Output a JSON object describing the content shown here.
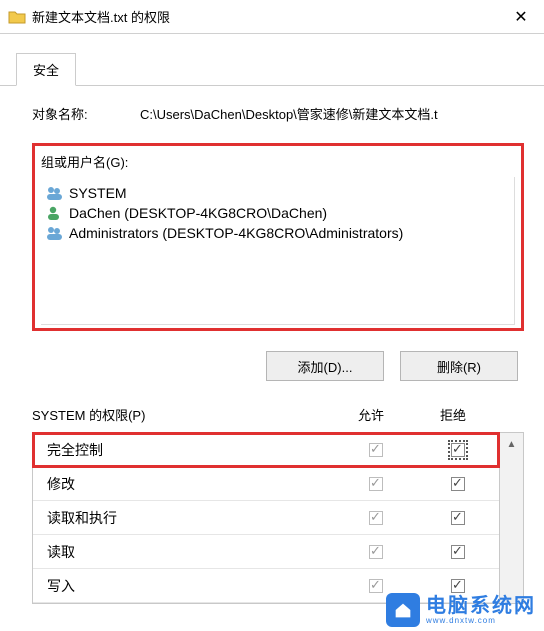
{
  "titlebar": {
    "title": "新建文本文档.txt 的权限"
  },
  "tab": {
    "label": "安全"
  },
  "object": {
    "label": "对象名称:",
    "path": "C:\\Users\\DaChen\\Desktop\\管家速修\\新建文本文档.t"
  },
  "groups": {
    "label": "组或用户名(G):",
    "items": [
      {
        "name": "SYSTEM",
        "icon": "group"
      },
      {
        "name": "DaChen (DESKTOP-4KG8CRO\\DaChen)",
        "icon": "user"
      },
      {
        "name": "Administrators (DESKTOP-4KG8CRO\\Administrators)",
        "icon": "group"
      }
    ]
  },
  "buttons": {
    "add": "添加(D)...",
    "remove": "删除(R)"
  },
  "perm_header": {
    "label": "SYSTEM 的权限(P)",
    "allow": "允许",
    "deny": "拒绝"
  },
  "permissions": [
    {
      "name": "完全控制",
      "allow": true,
      "deny": true,
      "highlight": true
    },
    {
      "name": "修改",
      "allow": true,
      "deny": true
    },
    {
      "name": "读取和执行",
      "allow": true,
      "deny": true
    },
    {
      "name": "读取",
      "allow": true,
      "deny": true
    },
    {
      "name": "写入",
      "allow": true,
      "deny": true
    }
  ],
  "watermark": {
    "text": "电脑系统网",
    "sub": "www.dnxtw.com"
  }
}
